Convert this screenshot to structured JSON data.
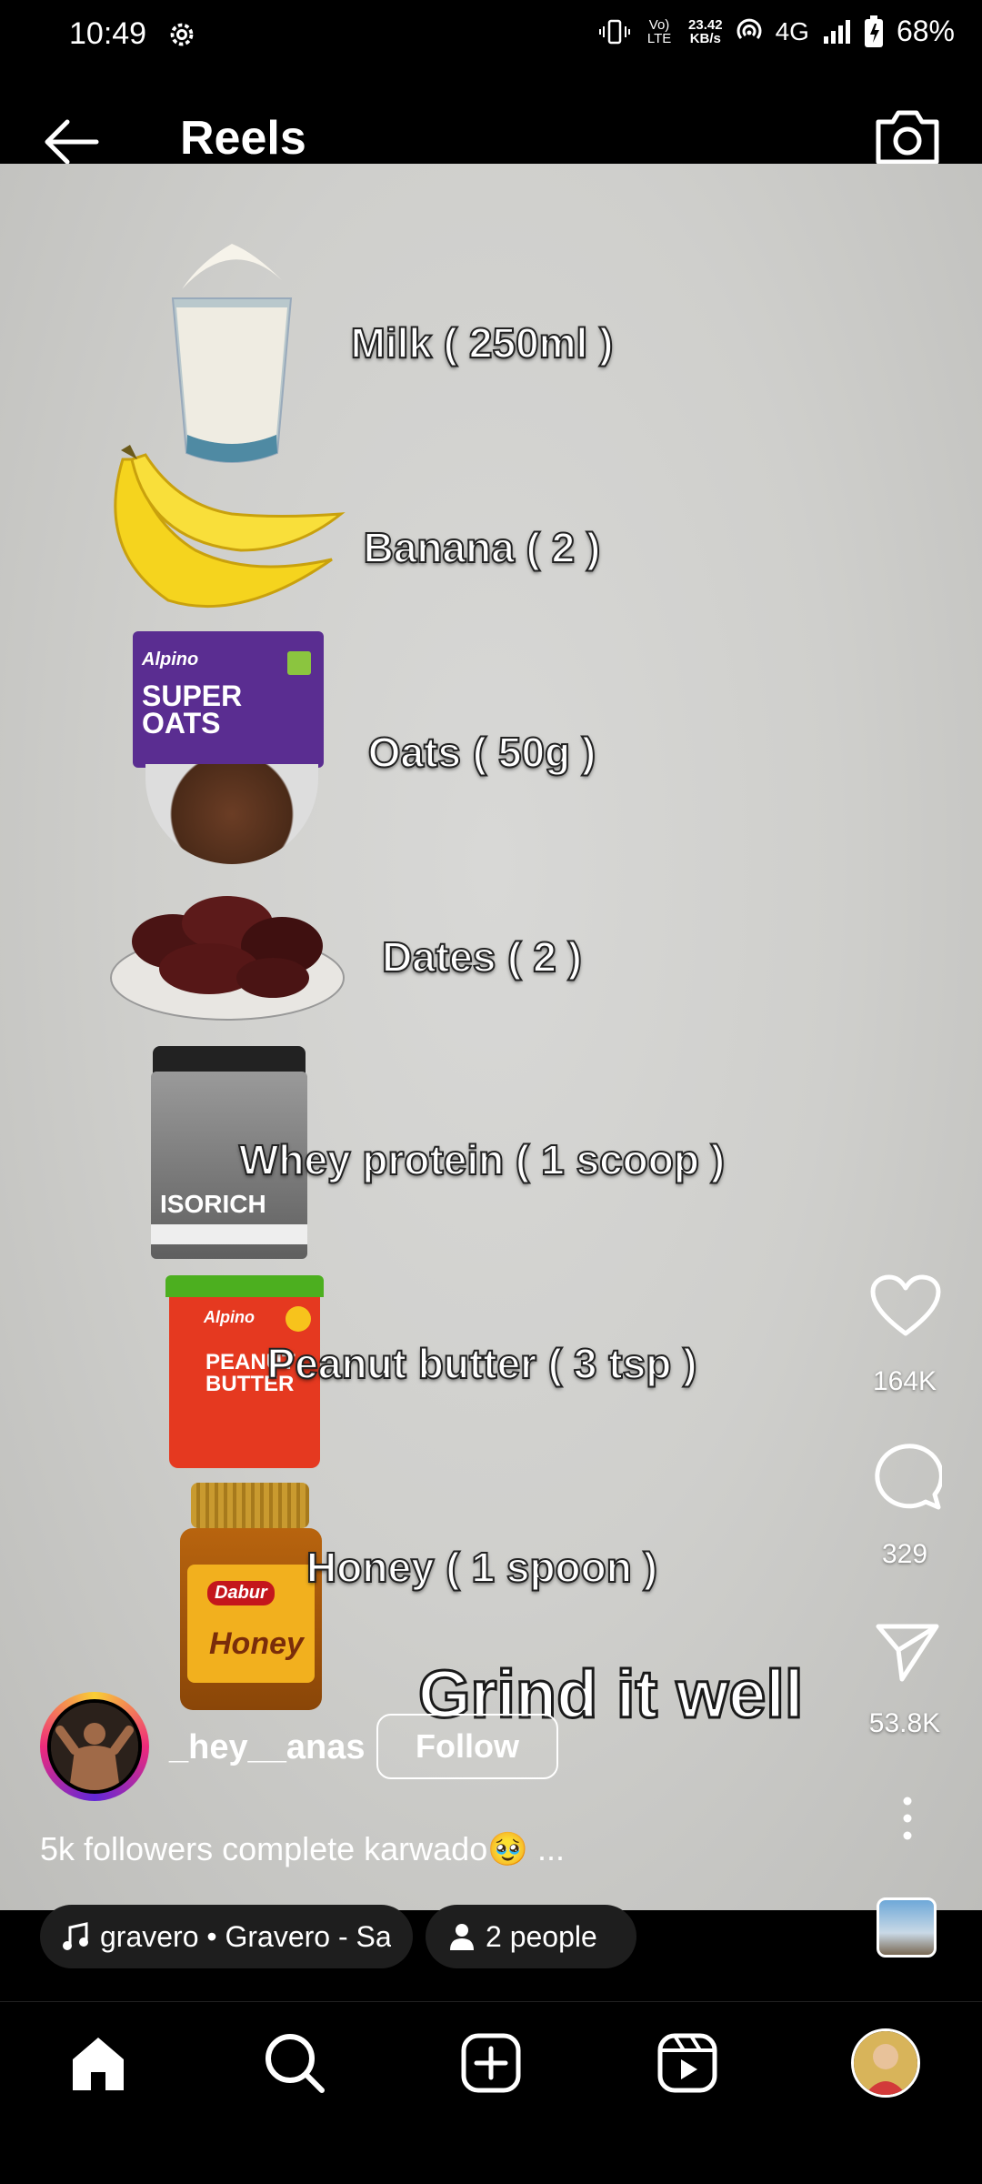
{
  "status_bar": {
    "time": "10:49",
    "network_line1": "Vo) LTE",
    "speed_value": "23.42",
    "speed_unit": "KB/s",
    "network_type": "4G",
    "battery": "68%"
  },
  "header": {
    "title": "Reels"
  },
  "reel": {
    "ingredients": [
      "Milk ( 250ml )",
      "Banana ( 2 )",
      "Oats ( 50g )",
      "Dates ( 2 )",
      "Whey protein ( 1 scoop )",
      "Peanut butter ( 3 tsp )",
      "Honey ( 1 spoon )"
    ],
    "overlay_text": "Grind it well",
    "product_labels": {
      "oats_brand": "Alpino",
      "oats_name": "SUPER OATS",
      "whey_name": "ISORICH",
      "pb_brand": "Alpino",
      "pb_name": "PEANUT BUTTER",
      "honey_brand": "Dabur",
      "honey_name": "Honey"
    }
  },
  "actions": {
    "likes": "164K",
    "comments": "329",
    "shares": "53.8K"
  },
  "author": {
    "username": "_hey__anas",
    "follow_label": "Follow",
    "caption": "5k followers complete karwado🥹 ..."
  },
  "pills": {
    "audio": "gravero • Gravero - Sat",
    "people": "2 people"
  },
  "colors": {
    "background": "#000000",
    "reel_bg": "#d0d0ce",
    "text": "#ffffff"
  }
}
